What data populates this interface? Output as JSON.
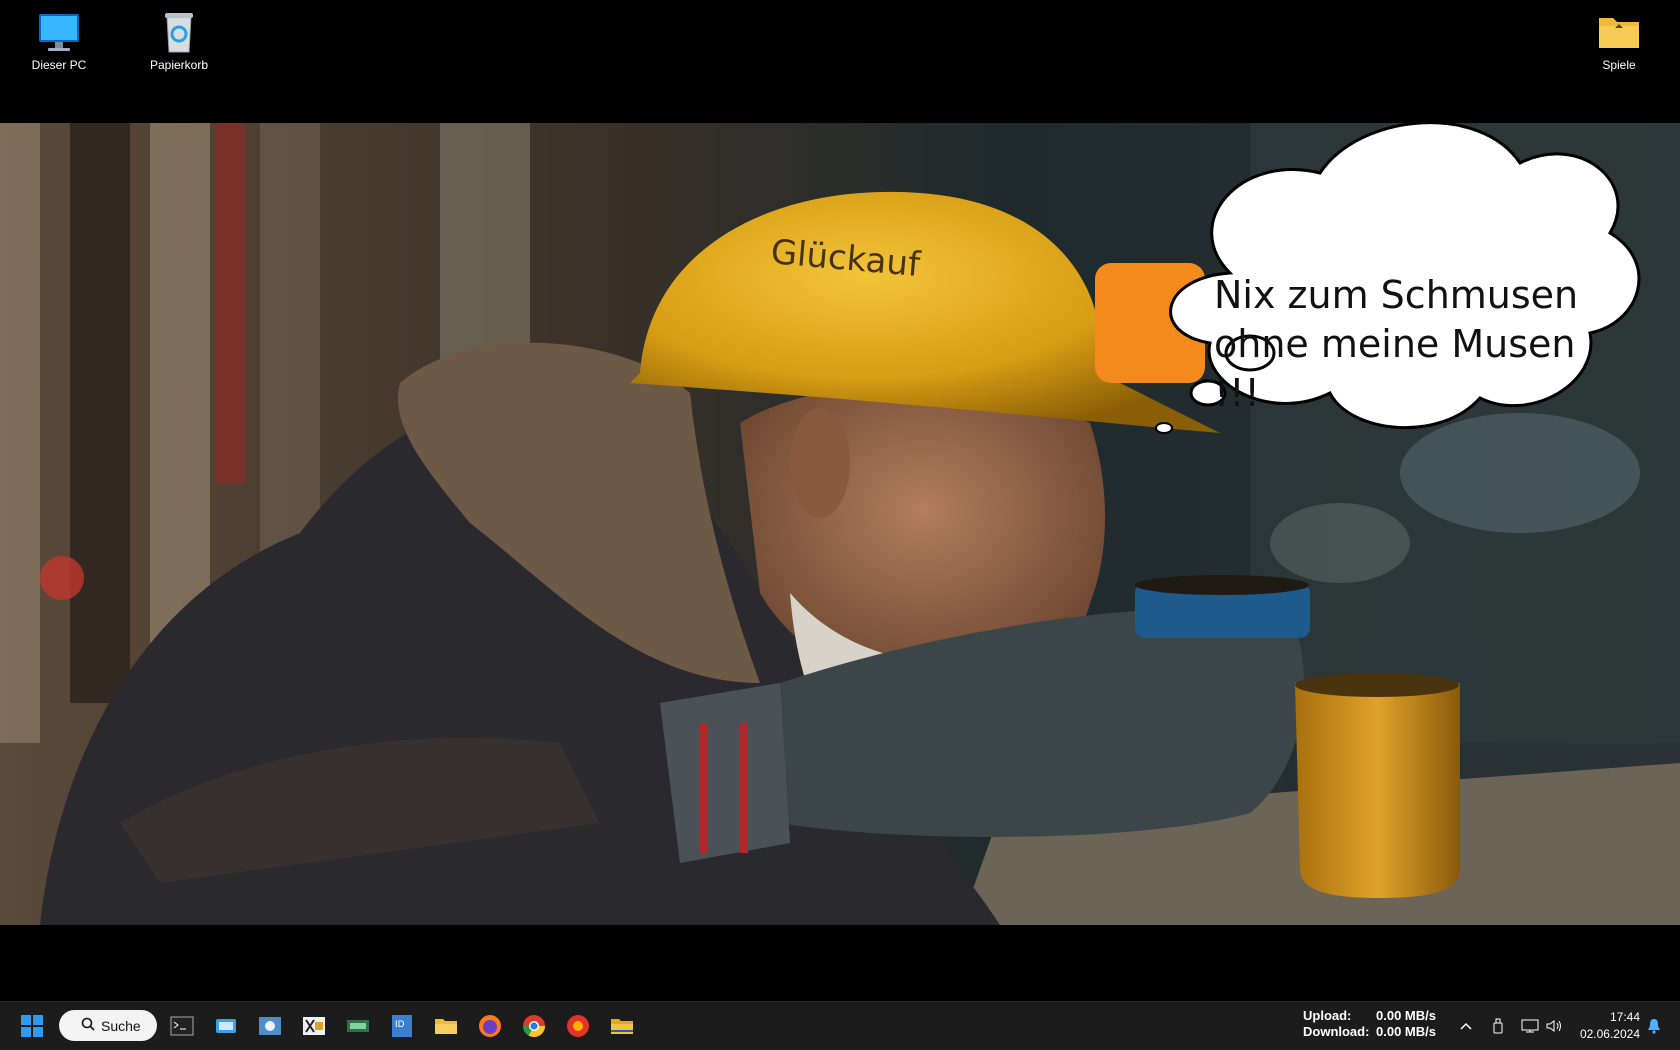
{
  "desktop": {
    "icons": [
      {
        "label": "Dieser PC",
        "icon": "monitor-icon"
      },
      {
        "label": "Papierkorb",
        "icon": "recycle-bin-icon"
      },
      {
        "label": "Spiele",
        "icon": "folder-icon"
      }
    ]
  },
  "wallpaper": {
    "thought_bubble_text": "Nix zum Schmusen\nohne meine Musen !!!",
    "helmet_text": "Glückauf"
  },
  "taskbar": {
    "search_label": "Suche",
    "pinned": [
      {
        "name": "start-icon"
      },
      {
        "name": "terminal-icon"
      },
      {
        "name": "app-icon-1"
      },
      {
        "name": "app-icon-2"
      },
      {
        "name": "app-icon-3"
      },
      {
        "name": "app-icon-4"
      },
      {
        "name": "app-icon-5"
      },
      {
        "name": "file-explorer-icon"
      },
      {
        "name": "firefox-icon"
      },
      {
        "name": "chrome-icon"
      },
      {
        "name": "app-icon-6"
      },
      {
        "name": "folder-icon"
      }
    ],
    "network": {
      "upload_label": "Upload:",
      "upload_value": "0.00 MB/s",
      "download_label": "Download:",
      "download_value": "0.00 MB/s"
    },
    "clock": {
      "time": "17:44",
      "date": "02.06.2024"
    }
  },
  "colors": {
    "taskbar": "#1c1c1c",
    "accent": "#0a7cd8",
    "helmet": "#d9a21b"
  }
}
